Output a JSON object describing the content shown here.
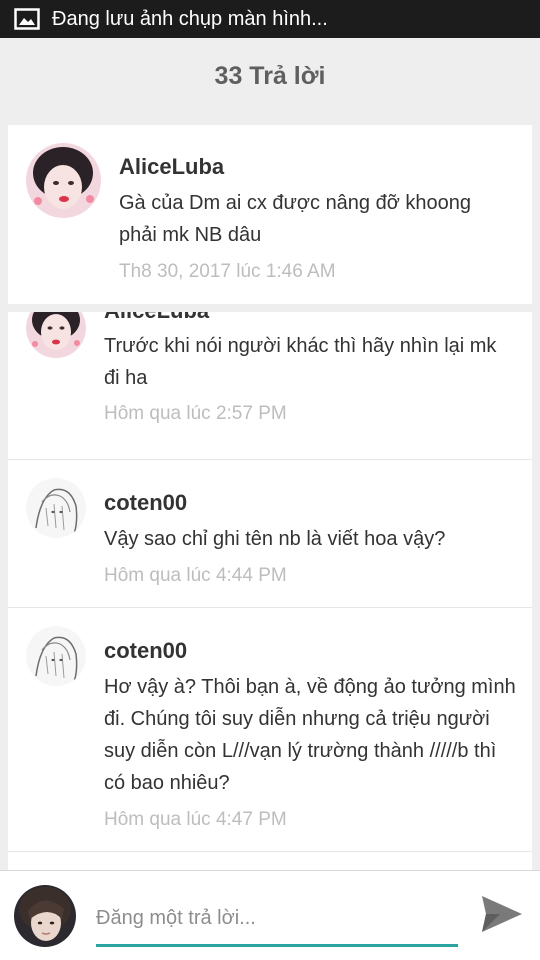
{
  "status_bar": {
    "notification_text": "Đang lưu ảnh chụp màn hình...",
    "icon": "image-icon"
  },
  "header": {
    "title": "33 Trả lời"
  },
  "main_post": {
    "author": "AliceLuba",
    "text": "Gà của Dm ai cx được nâng đỡ khoong phải mk NB dâu",
    "timestamp": "Th8 30, 2017 lúc 1:46 AM"
  },
  "replies": [
    {
      "author": "AliceLuba",
      "text": "Trước khi nói người khác thì hãy nhìn lại mk đi ha",
      "timestamp": "Hôm qua lúc 2:57 PM"
    },
    {
      "author": "coten00",
      "text": "Vậy sao chỉ ghi tên nb là viết hoa vậy?",
      "timestamp": "Hôm qua lúc 4:44 PM"
    },
    {
      "author": "coten00",
      "text": "Hơ vậy à? Thôi bạn à, về động ảo tưởng mình đi. Chúng tôi suy diễn nhưng cả triệu người suy diễn còn L///vạn lý trường thành /////b thì có bao nhiêu?",
      "timestamp": "Hôm qua lúc 4:47 PM"
    }
  ],
  "composer": {
    "placeholder": "Đăng một trả lời...",
    "send_icon": "send-icon"
  },
  "colors": {
    "accent": "#2aa3a1",
    "background": "#eeeeee",
    "status_bar": "#1c1c1c"
  }
}
